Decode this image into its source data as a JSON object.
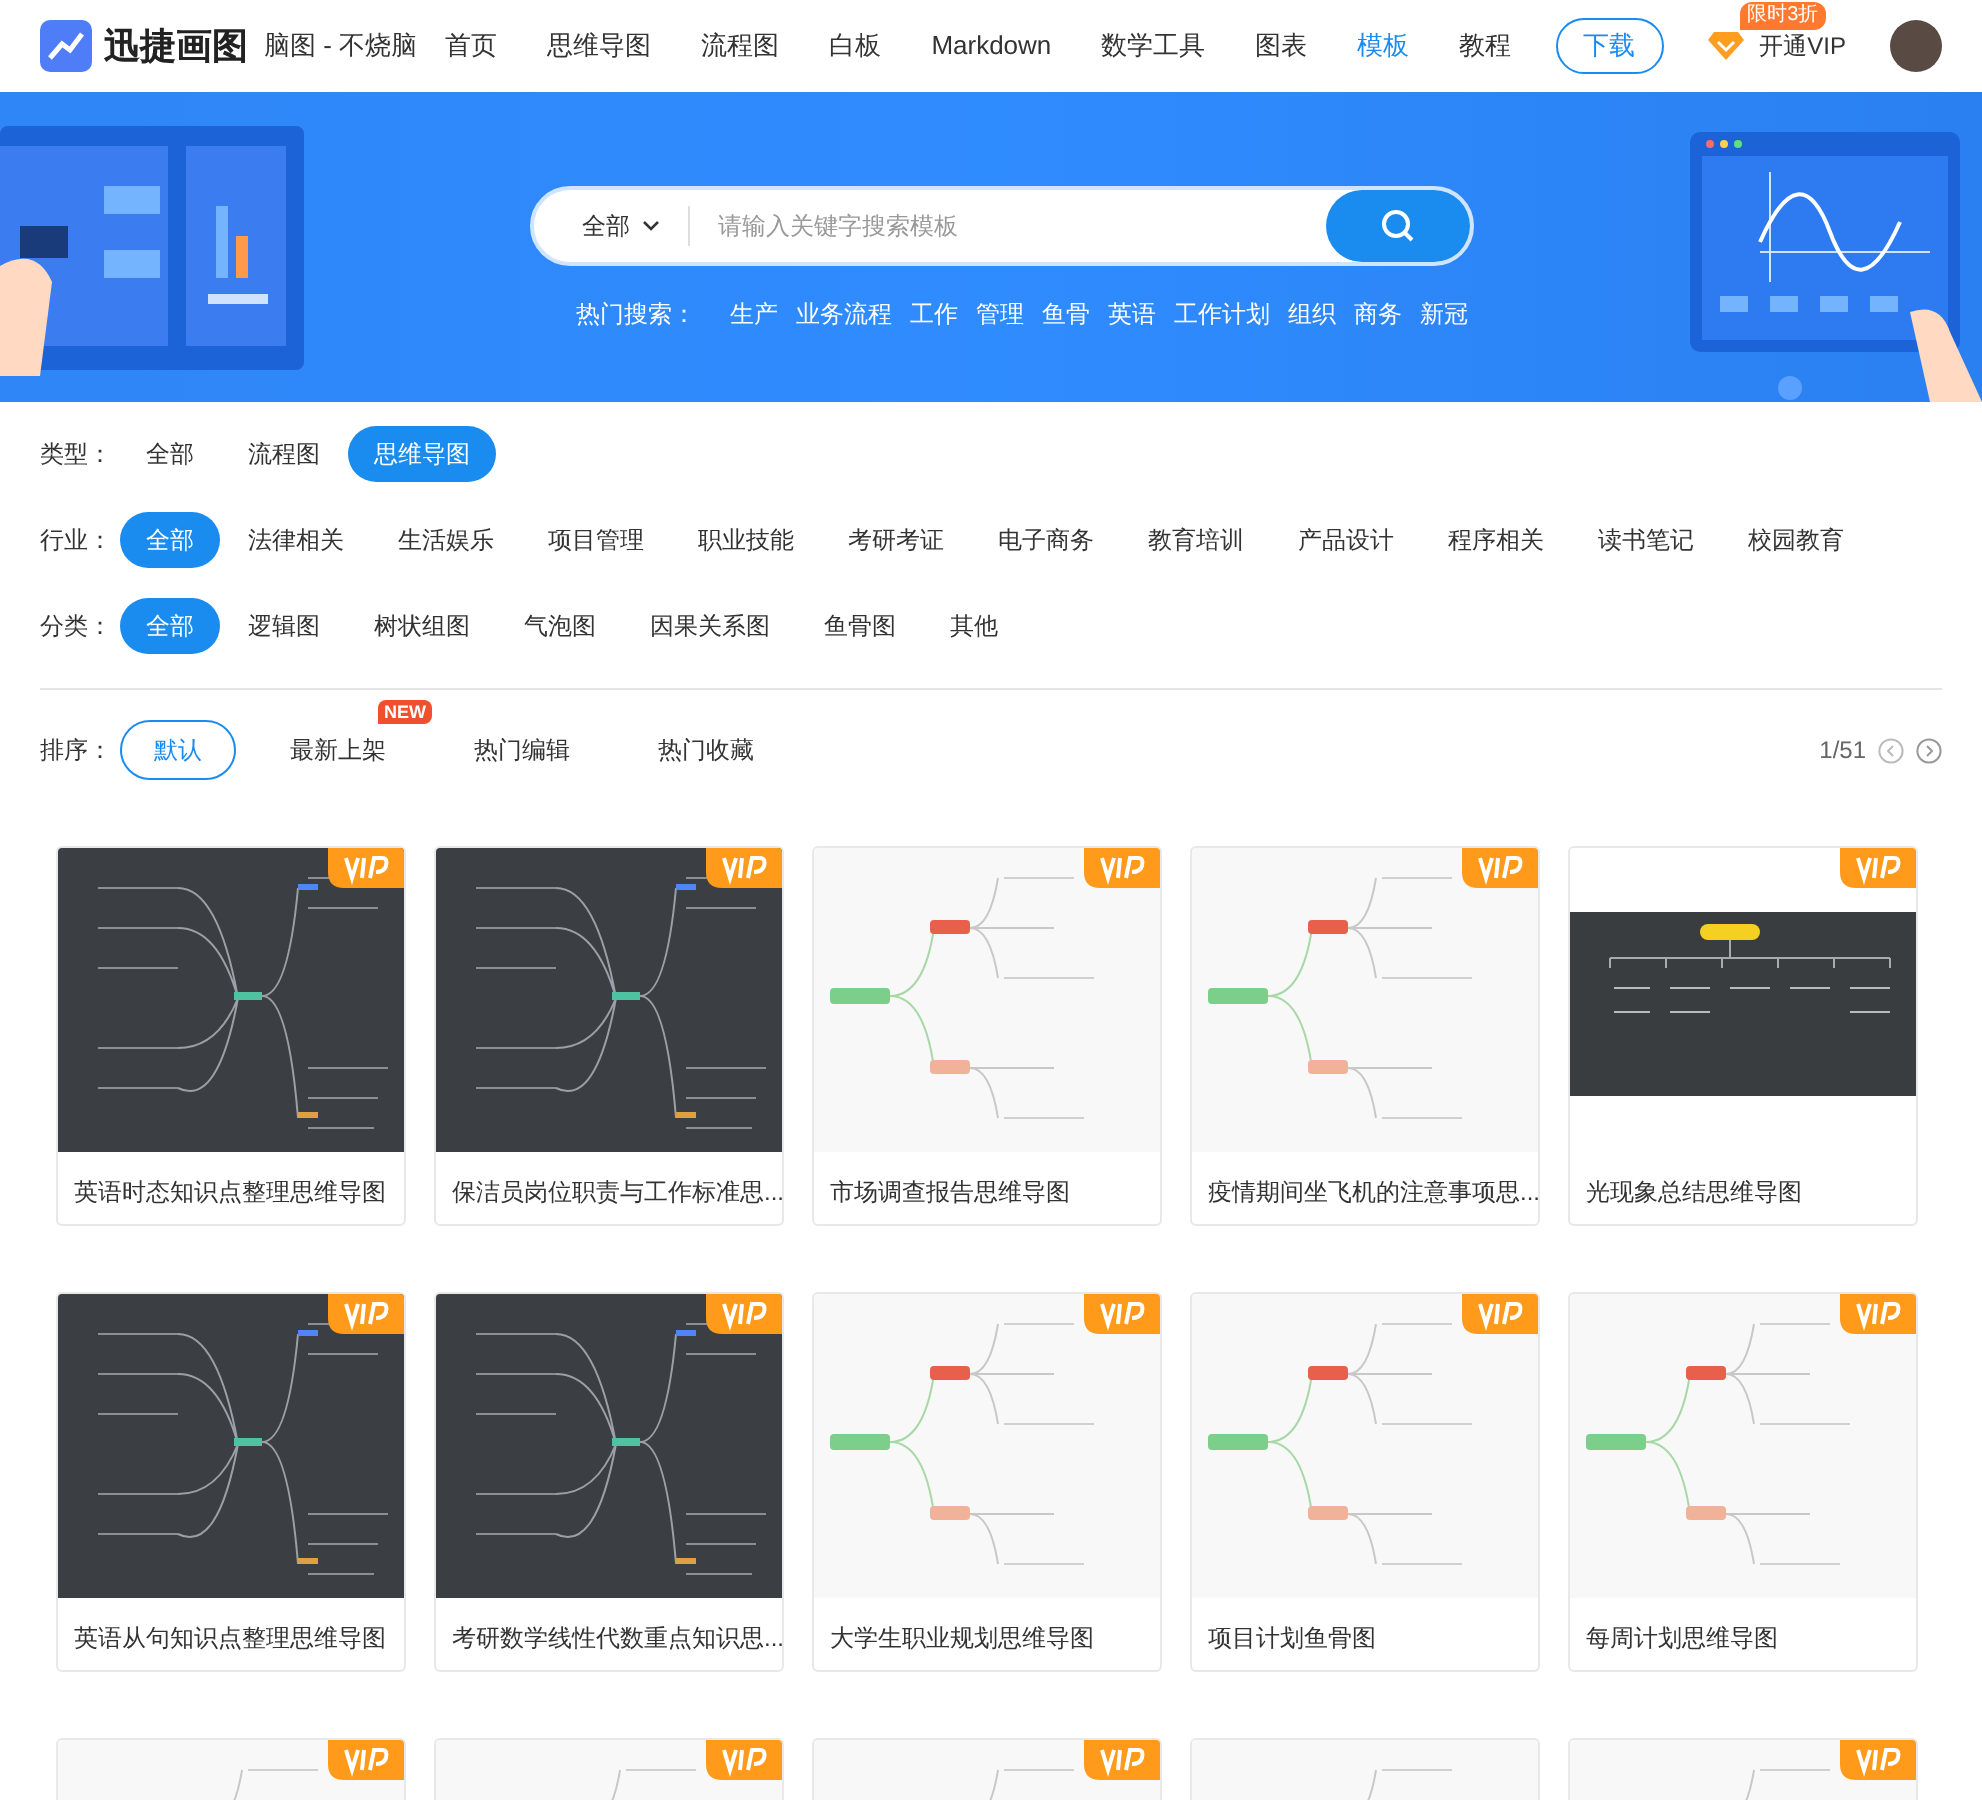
{
  "header": {
    "logo": "迅捷画图",
    "slogan": "脑图 - 不烧脑",
    "nav": [
      {
        "label": "首页",
        "selected": false
      },
      {
        "label": "思维导图",
        "selected": false
      },
      {
        "label": "流程图",
        "selected": false
      },
      {
        "label": "白板",
        "selected": false
      },
      {
        "label": "Markdown",
        "selected": false
      },
      {
        "label": "数学工具",
        "selected": false
      },
      {
        "label": "图表",
        "selected": false
      },
      {
        "label": "模板",
        "selected": true
      },
      {
        "label": "教程",
        "selected": false
      }
    ],
    "download": "下载",
    "vip_badge": "限时3折",
    "vip": "开通VIP"
  },
  "search": {
    "scope": "全部",
    "placeholder": "请输入关键字搜索模板",
    "hot_label": "热门搜索：",
    "hot": [
      "生产",
      "业务流程",
      "工作",
      "管理",
      "鱼骨",
      "英语",
      "工作计划",
      "组织",
      "商务",
      "新冠"
    ]
  },
  "filters": [
    {
      "label": "类型：",
      "options": [
        {
          "label": "全部",
          "selected": false
        },
        {
          "label": "流程图",
          "selected": false
        },
        {
          "label": "思维导图",
          "selected": true
        }
      ]
    },
    {
      "label": "行业：",
      "options": [
        {
          "label": "全部",
          "selected": true
        },
        {
          "label": "法律相关",
          "selected": false
        },
        {
          "label": "生活娱乐",
          "selected": false
        },
        {
          "label": "项目管理",
          "selected": false
        },
        {
          "label": "职业技能",
          "selected": false
        },
        {
          "label": "考研考证",
          "selected": false
        },
        {
          "label": "电子商务",
          "selected": false
        },
        {
          "label": "教育培训",
          "selected": false
        },
        {
          "label": "产品设计",
          "selected": false
        },
        {
          "label": "程序相关",
          "selected": false
        },
        {
          "label": "读书笔记",
          "selected": false
        },
        {
          "label": "校园教育",
          "selected": false
        }
      ]
    },
    {
      "label": "分类：",
      "options": [
        {
          "label": "全部",
          "selected": true
        },
        {
          "label": "逻辑图",
          "selected": false
        },
        {
          "label": "树状组图",
          "selected": false
        },
        {
          "label": "气泡图",
          "selected": false
        },
        {
          "label": "因果关系图",
          "selected": false
        },
        {
          "label": "鱼骨图",
          "selected": false
        },
        {
          "label": "其他",
          "selected": false
        }
      ]
    }
  ],
  "sort": {
    "label": "排序：",
    "options": [
      {
        "label": "默认",
        "selected": true
      },
      {
        "label": "最新上架",
        "selected": false,
        "badge": "NEW"
      },
      {
        "label": "热门编辑",
        "selected": false
      },
      {
        "label": "热门收藏",
        "selected": false
      }
    ],
    "page": "1/51"
  },
  "cards": [
    {
      "title": "英语时态知识点整理思维导图",
      "vip": true,
      "kind": "dark"
    },
    {
      "title": "保洁员岗位职责与工作标准思...",
      "vip": true,
      "kind": "dark"
    },
    {
      "title": "市场调查报告思维导图",
      "vip": true,
      "kind": "light"
    },
    {
      "title": "疫情期间坐飞机的注意事项思...",
      "vip": true,
      "kind": "light"
    },
    {
      "title": "光现象总结思维导图",
      "vip": true,
      "kind": "band"
    },
    {
      "title": "英语从句知识点整理思维导图",
      "vip": true,
      "kind": "dark"
    },
    {
      "title": "考研数学线性代数重点知识思...",
      "vip": true,
      "kind": "dark"
    },
    {
      "title": "大学生职业规划思维导图",
      "vip": true,
      "kind": "light"
    },
    {
      "title": "项目计划鱼骨图",
      "vip": true,
      "kind": "light"
    },
    {
      "title": "每周计划思维导图",
      "vip": true,
      "kind": "light"
    },
    {
      "vip": true,
      "kind": "light"
    },
    {
      "vip": true,
      "kind": "light"
    },
    {
      "vip": true,
      "kind": "light"
    },
    {
      "vip": false,
      "kind": "light"
    },
    {
      "vip": true,
      "kind": "light"
    }
  ]
}
